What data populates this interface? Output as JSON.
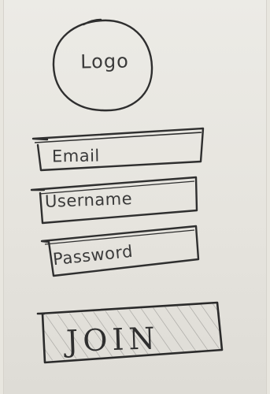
{
  "logo": {
    "label": "Logo"
  },
  "form": {
    "email_placeholder": "Email",
    "username_placeholder": "Username",
    "password_placeholder": "Password",
    "join_label": "JOIN"
  }
}
